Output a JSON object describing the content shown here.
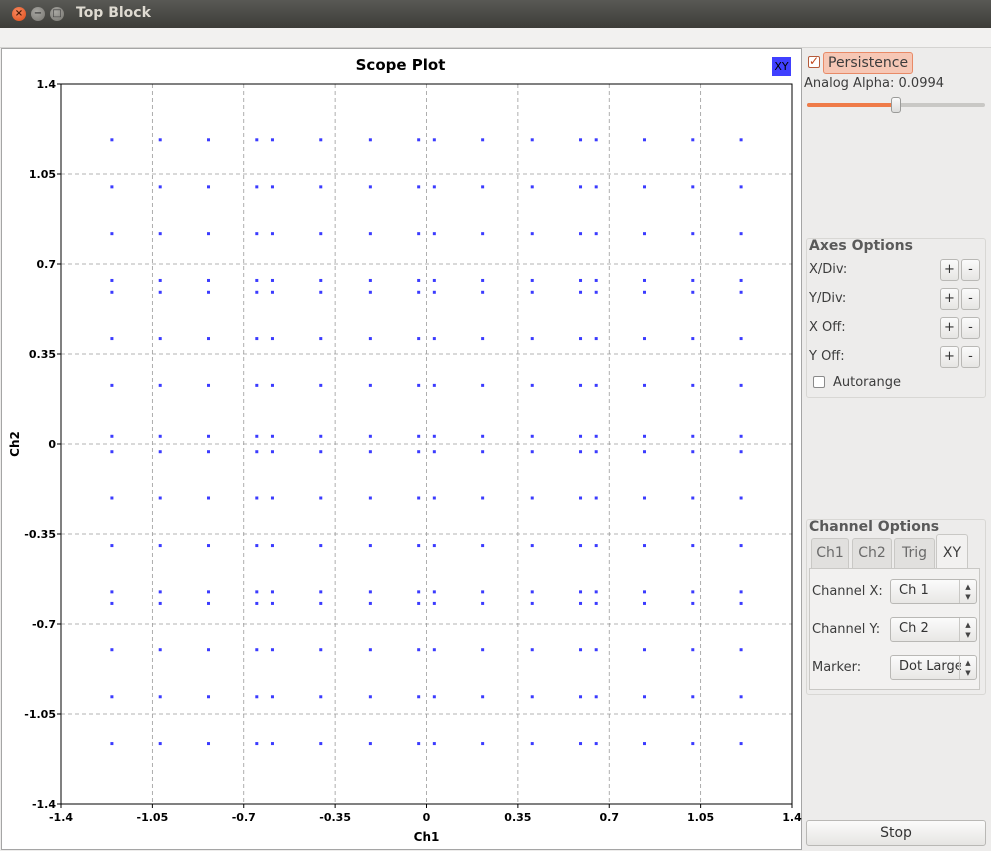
{
  "window": {
    "title": "Top Block"
  },
  "colors": {
    "trace": "#3b3bff",
    "xy_badge": "#4040ff",
    "accent": "#ef7b48"
  },
  "plot": {
    "title": "Scope Plot",
    "xy_badge": "XY",
    "xlabel": "Ch1",
    "ylabel": "Ch2"
  },
  "chart_data": {
    "type": "scatter",
    "title": "Scope Plot",
    "xlabel": "Ch1",
    "ylabel": "Ch2",
    "xlim": [
      -1.4,
      1.4
    ],
    "ylim": [
      -1.4,
      1.4
    ],
    "xticks": [
      -1.4,
      -1.05,
      -0.7,
      -0.35,
      0,
      0.35,
      0.7,
      1.05,
      1.4
    ],
    "yticks": [
      -1.4,
      -1.05,
      -0.7,
      -0.35,
      0,
      0.35,
      0.7,
      1.05,
      1.4
    ],
    "xtick_labels": [
      "-1.4",
      "-1.05",
      "-0.7",
      "-0.35",
      "0",
      "0.35",
      "0.7",
      "1.05",
      "1.4"
    ],
    "ytick_labels": [
      "-1.4",
      "-1.05",
      "-0.7",
      "-0.35",
      "0",
      "0.35",
      "0.7",
      "1.05",
      "1.4"
    ],
    "grid": true,
    "marker": "dot",
    "series": [
      {
        "x_values": [
          -1.205,
          -1.02,
          -0.835,
          -0.65,
          -0.59,
          -0.405,
          -0.215,
          -0.03,
          0.03,
          0.215,
          0.405,
          0.59,
          0.65,
          0.835,
          1.02,
          1.205
        ],
        "y_values": [
          1.183,
          1.0,
          0.818,
          0.636,
          0.59,
          0.41,
          0.228,
          0.03,
          -0.03,
          -0.21,
          -0.395,
          -0.575,
          -0.62,
          -0.8,
          -0.983,
          -1.165
        ]
      }
    ]
  },
  "side": {
    "persistence_label": "Persistence",
    "persistence_checked": true,
    "analog_alpha_label": "Analog Alpha: 0.0994",
    "analog_alpha_fraction": 0.5,
    "axes_options": {
      "title": "Axes Options",
      "rows": [
        {
          "label": "X/Div:",
          "plus": "+",
          "minus": "-"
        },
        {
          "label": "Y/Div:",
          "plus": "+",
          "minus": "-"
        },
        {
          "label": "X Off:",
          "plus": "+",
          "minus": "-"
        },
        {
          "label": "Y Off:",
          "plus": "+",
          "minus": "-"
        }
      ],
      "autorange_label": "Autorange",
      "autorange_checked": false
    },
    "channel_options": {
      "title": "Channel Options",
      "tabs": [
        "Ch1",
        "Ch2",
        "Trig",
        "XY"
      ],
      "active_tab": "XY",
      "rows": [
        {
          "label": "Channel X:",
          "value": "Ch 1"
        },
        {
          "label": "Channel Y:",
          "value": "Ch 2"
        },
        {
          "label": "Marker:",
          "value": "Dot Large"
        }
      ]
    },
    "stop_label": "Stop"
  }
}
